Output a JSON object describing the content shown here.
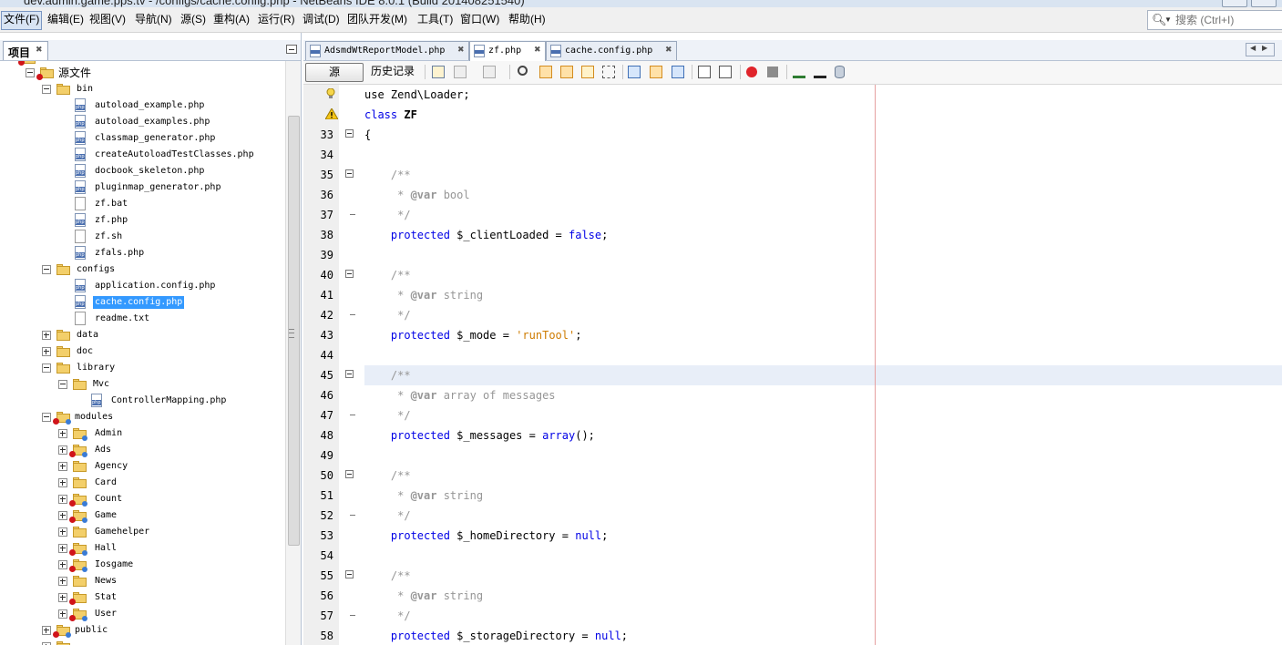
{
  "window": {
    "title": "dev.admin.game.pps.tv - /configs/cache.config.php - NetBeans IDE 8.0.1 (Build 201408251540)"
  },
  "menu": [
    "文件(F)",
    "编辑(E)",
    "视图(V)",
    "导航(N)",
    "源(S)",
    "重构(A)",
    "运行(R)",
    "调试(D)",
    "团队开发(M)",
    "工具(T)",
    "窗口(W)",
    "帮助(H)"
  ],
  "search": {
    "placeholder": "搜索 (Ctrl+I)"
  },
  "projects": {
    "tab": "项目",
    "tree": [
      {
        "label": "源文件"
      },
      {
        "label": "bin"
      },
      {
        "label": "autoload_example.php"
      },
      {
        "label": "autoload_examples.php"
      },
      {
        "label": "classmap_generator.php"
      },
      {
        "label": "createAutoloadTestClasses.php"
      },
      {
        "label": "docbook_skeleton.php"
      },
      {
        "label": "pluginmap_generator.php"
      },
      {
        "label": "zf.bat"
      },
      {
        "label": "zf.php"
      },
      {
        "label": "zf.sh"
      },
      {
        "label": "zfals.php"
      },
      {
        "label": "configs"
      },
      {
        "label": "application.config.php"
      },
      {
        "label": "cache.config.php",
        "selected": true
      },
      {
        "label": "readme.txt"
      },
      {
        "label": "data"
      },
      {
        "label": "doc"
      },
      {
        "label": "library"
      },
      {
        "label": "Mvc"
      },
      {
        "label": "ControllerMapping.php"
      },
      {
        "label": "modules"
      },
      {
        "label": "Admin"
      },
      {
        "label": "Ads"
      },
      {
        "label": "Agency"
      },
      {
        "label": "Card"
      },
      {
        "label": "Count"
      },
      {
        "label": "Game"
      },
      {
        "label": "Gamehelper"
      },
      {
        "label": "Hall"
      },
      {
        "label": "Iosgame"
      },
      {
        "label": "News"
      },
      {
        "label": "Stat"
      },
      {
        "label": "User"
      },
      {
        "label": "public"
      }
    ]
  },
  "editor": {
    "tabs": [
      "AdsmdWtReportModel.php",
      "zf.php",
      "cache.config.php"
    ],
    "toolbar": {
      "source": "源",
      "history": "历史记录"
    },
    "lines": [
      {
        "n": "",
        "code": [
          {
            "t": "use Zend\\Loader;"
          }
        ]
      },
      {
        "n": "",
        "code": [
          {
            "t": "class ",
            "c": "kw"
          },
          {
            "t": "ZF",
            "c": "bold"
          }
        ]
      },
      {
        "n": "33",
        "code": [
          {
            "t": "{"
          }
        ]
      },
      {
        "n": "34",
        "code": []
      },
      {
        "n": "35",
        "code": [
          {
            "t": "    /**",
            "c": "cm"
          }
        ]
      },
      {
        "n": "36",
        "code": [
          {
            "t": "     * ",
            "c": "cm"
          },
          {
            "t": "@var",
            "c": "cm bold"
          },
          {
            "t": " bool",
            "c": "cm"
          }
        ]
      },
      {
        "n": "37",
        "code": [
          {
            "t": "     */",
            "c": "cm"
          }
        ]
      },
      {
        "n": "38",
        "code": [
          {
            "t": "    protected ",
            "c": "kw"
          },
          {
            "t": "$_clientLoaded",
            "c": "var"
          },
          {
            "t": " = "
          },
          {
            "t": "false",
            "c": "kw"
          },
          {
            "t": ";"
          }
        ]
      },
      {
        "n": "39",
        "code": []
      },
      {
        "n": "40",
        "code": [
          {
            "t": "    /**",
            "c": "cm"
          }
        ]
      },
      {
        "n": "41",
        "code": [
          {
            "t": "     * ",
            "c": "cm"
          },
          {
            "t": "@var",
            "c": "cm bold"
          },
          {
            "t": " string",
            "c": "cm"
          }
        ]
      },
      {
        "n": "42",
        "code": [
          {
            "t": "     */",
            "c": "cm"
          }
        ]
      },
      {
        "n": "43",
        "code": [
          {
            "t": "    protected ",
            "c": "kw"
          },
          {
            "t": "$_mode",
            "c": "var"
          },
          {
            "t": " = "
          },
          {
            "t": "'runTool'",
            "c": "str"
          },
          {
            "t": ";"
          }
        ]
      },
      {
        "n": "44",
        "code": []
      },
      {
        "n": "45",
        "code": [
          {
            "t": "    /**",
            "c": "cm"
          }
        ]
      },
      {
        "n": "46",
        "code": [
          {
            "t": "     * ",
            "c": "cm"
          },
          {
            "t": "@var",
            "c": "cm bold"
          },
          {
            "t": " array of messages",
            "c": "cm"
          }
        ]
      },
      {
        "n": "47",
        "code": [
          {
            "t": "     */",
            "c": "cm"
          }
        ]
      },
      {
        "n": "48",
        "code": [
          {
            "t": "    protected ",
            "c": "kw"
          },
          {
            "t": "$_messages",
            "c": "var"
          },
          {
            "t": " = "
          },
          {
            "t": "array",
            "c": "kw"
          },
          {
            "t": "();"
          }
        ]
      },
      {
        "n": "49",
        "code": []
      },
      {
        "n": "50",
        "code": [
          {
            "t": "    /**",
            "c": "cm"
          }
        ]
      },
      {
        "n": "51",
        "code": [
          {
            "t": "     * ",
            "c": "cm"
          },
          {
            "t": "@var",
            "c": "cm bold"
          },
          {
            "t": " string",
            "c": "cm"
          }
        ]
      },
      {
        "n": "52",
        "code": [
          {
            "t": "     */",
            "c": "cm"
          }
        ]
      },
      {
        "n": "53",
        "code": [
          {
            "t": "    protected ",
            "c": "kw"
          },
          {
            "t": "$_homeDirectory",
            "c": "var"
          },
          {
            "t": " = "
          },
          {
            "t": "null",
            "c": "kw"
          },
          {
            "t": ";"
          }
        ]
      },
      {
        "n": "54",
        "code": []
      },
      {
        "n": "55",
        "code": [
          {
            "t": "    /**",
            "c": "cm"
          }
        ]
      },
      {
        "n": "56",
        "code": [
          {
            "t": "     * ",
            "c": "cm"
          },
          {
            "t": "@var",
            "c": "cm bold"
          },
          {
            "t": " string",
            "c": "cm"
          }
        ]
      },
      {
        "n": "57",
        "code": [
          {
            "t": "     */",
            "c": "cm"
          }
        ]
      },
      {
        "n": "58",
        "code": [
          {
            "t": "    protected ",
            "c": "kw"
          },
          {
            "t": "$_storageDirectory",
            "c": "var"
          },
          {
            "t": " = "
          },
          {
            "t": "null",
            "c": "kw"
          },
          {
            "t": ";"
          }
        ]
      }
    ]
  }
}
